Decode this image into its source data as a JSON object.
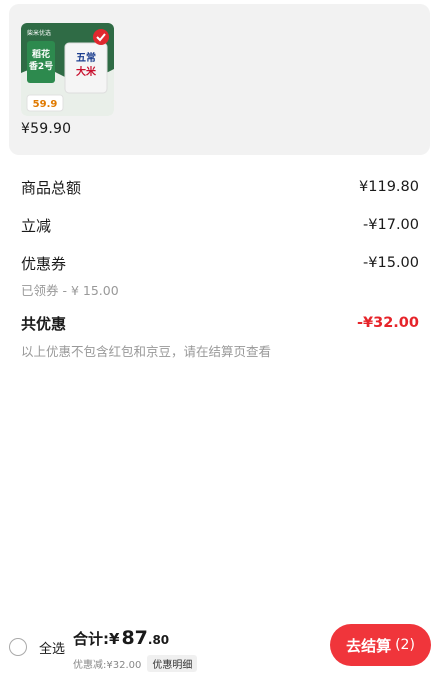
{
  "product": {
    "price": "¥59.90",
    "thumb_brand": "稻花香2号",
    "thumb_label": "五常大米",
    "thumb_price": "59.9"
  },
  "summary": {
    "subtotal": {
      "label": "商品总额",
      "value": "¥119.80"
    },
    "instant_discount": {
      "label": "立减",
      "value": "-¥17.00"
    },
    "coupon": {
      "label": "优惠券",
      "value": "-¥15.00",
      "note": "已领券 - ¥ 15.00"
    },
    "total_discount": {
      "label": "共优惠",
      "value": "-¥32.00"
    },
    "footnote": "以上优惠不包含红包和京豆，请在结算页查看"
  },
  "bottom_bar": {
    "select_all": "全选",
    "total_label": "合计:",
    "total_currency": "¥",
    "total_int": "87",
    "total_dec": ".80",
    "discount_text": "优惠减:¥32.00",
    "discount_detail": "优惠明细",
    "checkout_label": "去结算",
    "checkout_count": "(2)"
  },
  "colors": {
    "accent_red": "#e6242a",
    "button_red": "#f0353b",
    "muted_text": "#999999"
  }
}
